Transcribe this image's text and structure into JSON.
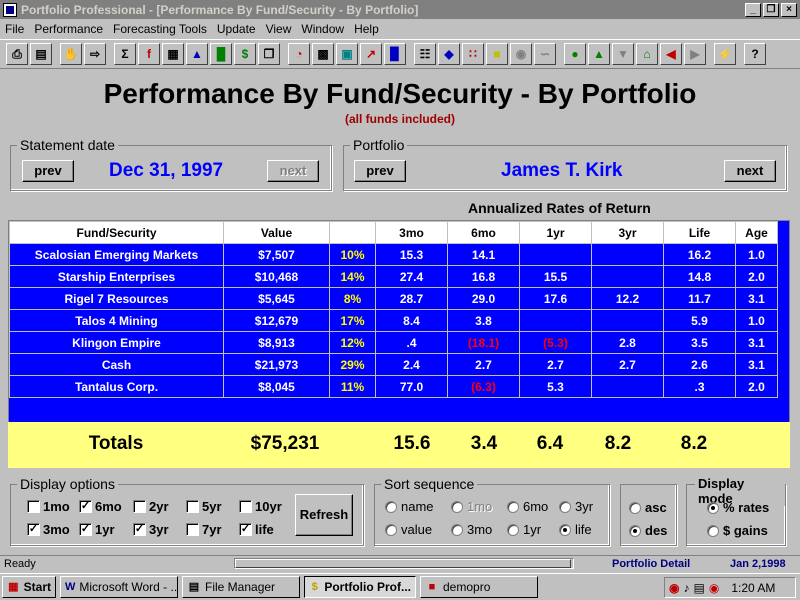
{
  "window": {
    "title": "Portfolio Professional - [Performance By Fund/Security - By Portfolio]"
  },
  "menu": [
    "File",
    "Performance",
    "Forecasting Tools",
    "Update",
    "View",
    "Window",
    "Help"
  ],
  "report": {
    "title": "Performance By Fund/Security - By Portfolio",
    "subtitle": "(all funds included)"
  },
  "statement": {
    "label": "Statement date",
    "prev": "prev",
    "date": "Dec 31, 1997",
    "next": "next"
  },
  "portfolio": {
    "label": "Portfolio",
    "prev": "prev",
    "name": "James T. Kirk",
    "next": "next"
  },
  "roe_header": "Annualized Rates of Return",
  "table": {
    "headers": [
      "Fund/Security",
      "Value",
      "",
      "3mo",
      "6mo",
      "1yr",
      "3yr",
      "Life",
      "Age"
    ],
    "rows": [
      [
        "Scalosian Emerging Markets",
        "$7,507",
        "10%",
        "15.3",
        "14.1",
        "",
        "",
        "16.2",
        "1.0"
      ],
      [
        "Starship Enterprises",
        "$10,468",
        "14%",
        "27.4",
        "16.8",
        "15.5",
        "",
        "14.8",
        "2.0"
      ],
      [
        "Rigel 7 Resources",
        "$5,645",
        "8%",
        "28.7",
        "29.0",
        "17.6",
        "12.2",
        "11.7",
        "3.1"
      ],
      [
        "Talos 4 Mining",
        "$12,679",
        "17%",
        "8.4",
        "3.8",
        "",
        "",
        "5.9",
        "1.0"
      ],
      [
        "Klingon Empire",
        "$8,913",
        "12%",
        ".4",
        "(18.1)",
        "(5.3)",
        "2.8",
        "3.5",
        "3.1"
      ],
      [
        "Cash",
        "$21,973",
        "29%",
        "2.4",
        "2.7",
        "2.7",
        "2.7",
        "2.6",
        "3.1"
      ],
      [
        "Tantalus Corp.",
        "$8,045",
        "11%",
        "77.0",
        "(6.3)",
        "5.3",
        "",
        ".3",
        "2.0"
      ]
    ]
  },
  "totals": {
    "label": "Totals",
    "value": "$75,231",
    "m3": "15.6",
    "m6": "3.4",
    "y1": "6.4",
    "y3": "8.2",
    "life": "8.2"
  },
  "display_options": {
    "label": "Display options",
    "items": [
      {
        "label": "1mo",
        "checked": false
      },
      {
        "label": "6mo",
        "checked": true
      },
      {
        "label": "2yr",
        "checked": false
      },
      {
        "label": "5yr",
        "checked": false
      },
      {
        "label": "10yr",
        "checked": false
      },
      {
        "label": "3mo",
        "checked": true
      },
      {
        "label": "1yr",
        "checked": true
      },
      {
        "label": "3yr",
        "checked": true
      },
      {
        "label": "7yr",
        "checked": false
      },
      {
        "label": "life",
        "checked": true
      }
    ],
    "refresh": "Refresh"
  },
  "sort": {
    "label": "Sort sequence",
    "items": [
      {
        "label": "name",
        "selected": false,
        "disabled": false
      },
      {
        "label": "1mo",
        "selected": false,
        "disabled": true
      },
      {
        "label": "6mo",
        "selected": false,
        "disabled": false
      },
      {
        "label": "3yr",
        "selected": false,
        "disabled": false
      },
      {
        "label": "value",
        "selected": false,
        "disabled": false
      },
      {
        "label": "3mo",
        "selected": false,
        "disabled": false
      },
      {
        "label": "1yr",
        "selected": false,
        "disabled": false
      },
      {
        "label": "life",
        "selected": true,
        "disabled": false
      }
    ],
    "asc": "asc",
    "des": "des"
  },
  "display_mode": {
    "label": "Display mode",
    "rates": "% rates",
    "gains": "$ gains"
  },
  "status": {
    "left": "Ready",
    "view": "Portfolio Detail",
    "date": "Jan 2,1998"
  },
  "taskbar": {
    "start": "Start",
    "tasks": [
      "Microsoft Word - ...",
      "File Manager",
      "Portfolio Prof...",
      "demopro"
    ],
    "clock": "1:20 AM"
  },
  "colors": {
    "table_bg": "#0000ff",
    "totals_bg": "#ffff80",
    "negative": "#ff0000",
    "percent": "#ffff00",
    "accent_blue": "#0000ff",
    "subtitle": "#a00000"
  }
}
